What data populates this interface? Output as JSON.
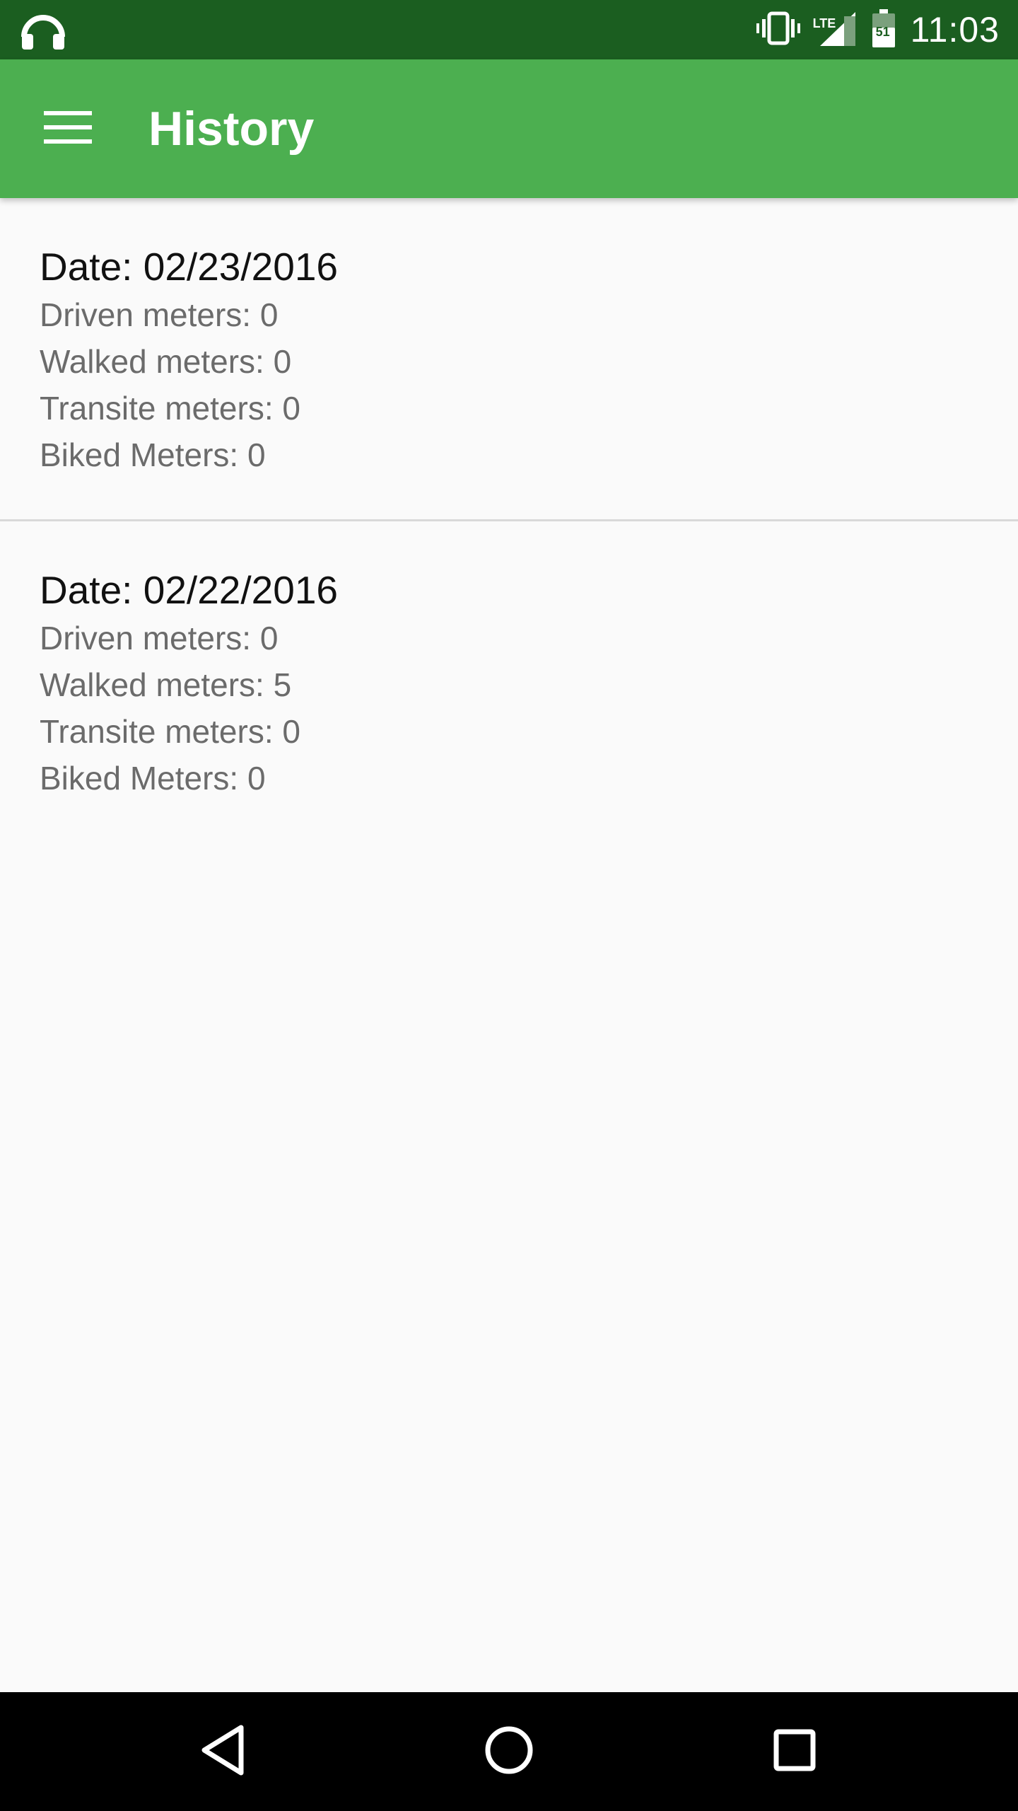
{
  "status_bar": {
    "time": "11:03",
    "battery_level": "51",
    "network_label": "LTE",
    "icons": [
      "headphones-icon",
      "vibrate-icon",
      "signal-icon",
      "battery-icon"
    ]
  },
  "app_bar": {
    "title": "History",
    "menu_icon": "hamburger-menu-icon",
    "background": "#4caf50"
  },
  "history": [
    {
      "date": "Date: 02/23/2016",
      "driven": "Driven meters: 0",
      "walked": "Walked meters: 0",
      "transit": "Transite meters: 0",
      "biked": "Biked Meters: 0"
    },
    {
      "date": "Date: 02/22/2016",
      "driven": "Driven meters: 0",
      "walked": "Walked meters: 5",
      "transit": "Transite meters: 0",
      "biked": "Biked Meters: 0"
    }
  ],
  "nav_bar": {
    "icons": [
      "back-icon",
      "home-icon",
      "recent-apps-icon"
    ]
  },
  "colors": {
    "status_bar": "#1b5e20",
    "app_bar": "#4caf50",
    "background": "#fafafa"
  }
}
